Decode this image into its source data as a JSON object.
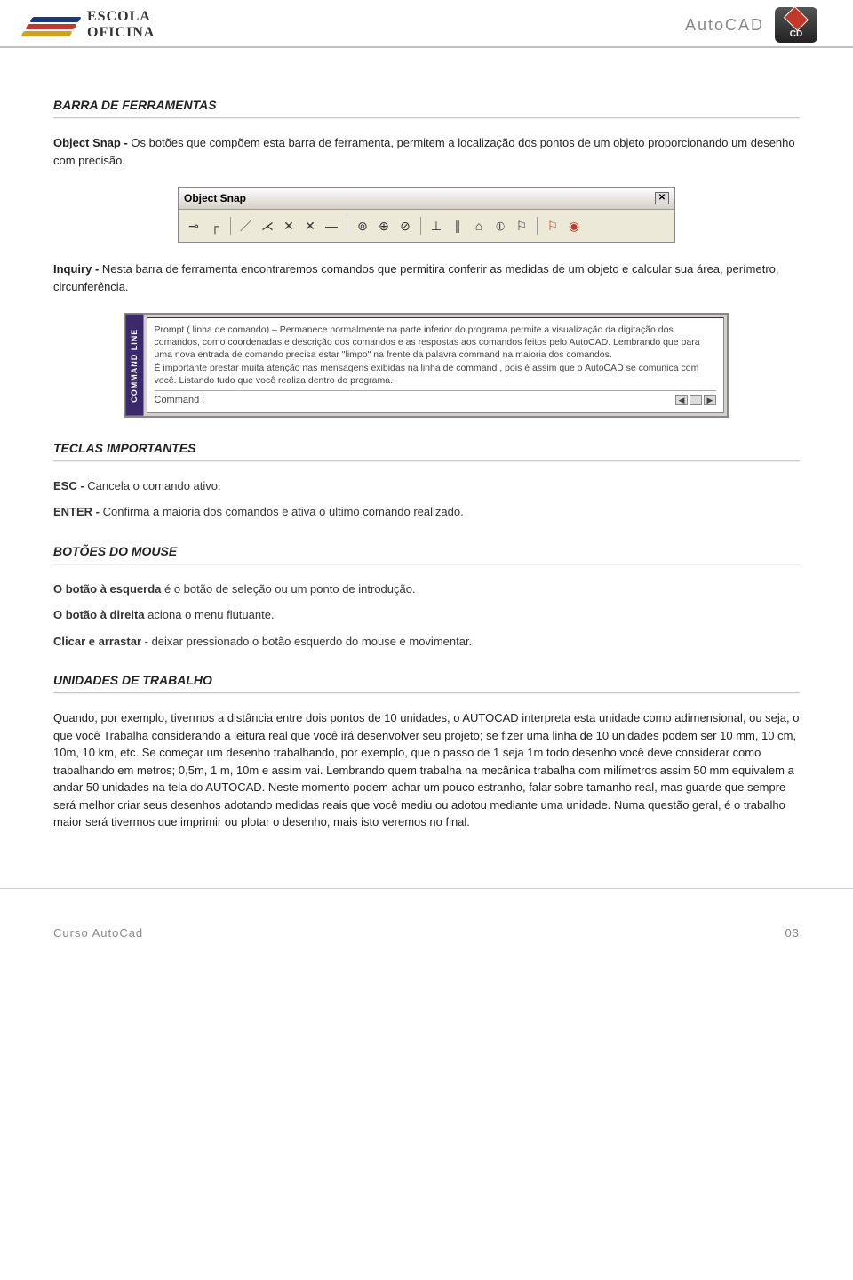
{
  "header": {
    "logo_line1": "ESCOLA",
    "logo_line2": "OFICINA",
    "title": "AutoCAD",
    "cd_label": "CD"
  },
  "sections": {
    "barra": {
      "title": "BARRA DE FERRAMENTAS",
      "p1_bold": "Object Snap - ",
      "p1_rest": "Os botões que compõem esta barra de ferramenta, permitem a localização dos pontos de um objeto proporcionando um desenho com precisão.",
      "toolbar_title": "Object Snap",
      "p2_bold": "Inquiry - ",
      "p2_rest": "Nesta barra de ferramenta encontraremos comandos que permitira conferir as medidas de um objeto e calcular sua área, perímetro, circunferência."
    },
    "cmdline": {
      "tab": "COMMAND LINE",
      "body": "Prompt ( linha de comando) – Permanece normalmente na  parte inferior do programa permite a visualização da digitação dos comandos, como coordenadas e descrição dos comandos e as respostas aos comandos feitos pelo AutoCAD. Lembrando que para uma nova entrada de comando precisa estar \"limpo\" na frente da palavra command na maioria dos comandos.\nÉ importante prestar muita atenção nas mensagens exibidas na linha de command , pois é assim que o AutoCAD se comunica com você. Listando tudo que você realiza dentro do programa.",
      "prompt": "Command :"
    },
    "teclas": {
      "title": "TECLAS IMPORTANTES",
      "esc_lead": "ESC - ",
      "esc_rest": "Cancela o comando ativo.",
      "enter_lead": "ENTER - ",
      "enter_rest": "Confirma a maioria dos comandos e ativa o ultimo comando realizado."
    },
    "mouse": {
      "title": "BOTÕES DO MOUSE",
      "l1_lead": "O botão à esquerda ",
      "l1_rest": "é o botão de seleção ou um ponto de introdução.",
      "l2_lead": "O botão à direita ",
      "l2_rest": "aciona o menu flutuante.",
      "l3_lead": "Clicar e arrastar  ",
      "l3_rest": "- deixar pressionado o botão esquerdo do mouse e movimentar."
    },
    "unidades": {
      "title": "UNIDADES DE TRABALHO",
      "body": "Quando, por exemplo, tivermos a distância entre dois pontos de 10 unidades, o AUTOCAD interpreta esta unidade como adimensional, ou seja, o que você Trabalha considerando a leitura real que você irá desenvolver seu projeto; se fizer uma linha de 10 unidades podem ser 10 mm, 10 cm, 10m, 10 km, etc. Se começar um desenho trabalhando, por exemplo, que o passo de 1 seja 1m todo desenho você deve considerar como trabalhando em metros; 0,5m, 1 m, 10m e assim vai. Lembrando quem trabalha na mecânica trabalha com milímetros assim 50 mm equivalem a andar 50 unidades na tela do AUTOCAD. Neste momento podem achar um pouco estranho, falar sobre tamanho real, mas guarde que sempre será melhor criar seus desenhos adotando medidas reais que você mediu ou adotou mediante uma unidade. Numa questão geral, é o trabalho maior será tivermos que imprimir ou plotar o desenho, mais isto veremos no final."
    }
  },
  "footer": {
    "left": "Curso AutoCad",
    "right": "03"
  },
  "icons": {
    "snap": [
      "⊸",
      "┌",
      "·",
      "／",
      "⋌",
      "✕",
      "✕",
      "—",
      "·",
      "⊚",
      "⊕",
      "⊘",
      "⊥",
      "⦶",
      "·",
      "∥",
      "⌂",
      "⚐",
      "◉"
    ]
  }
}
